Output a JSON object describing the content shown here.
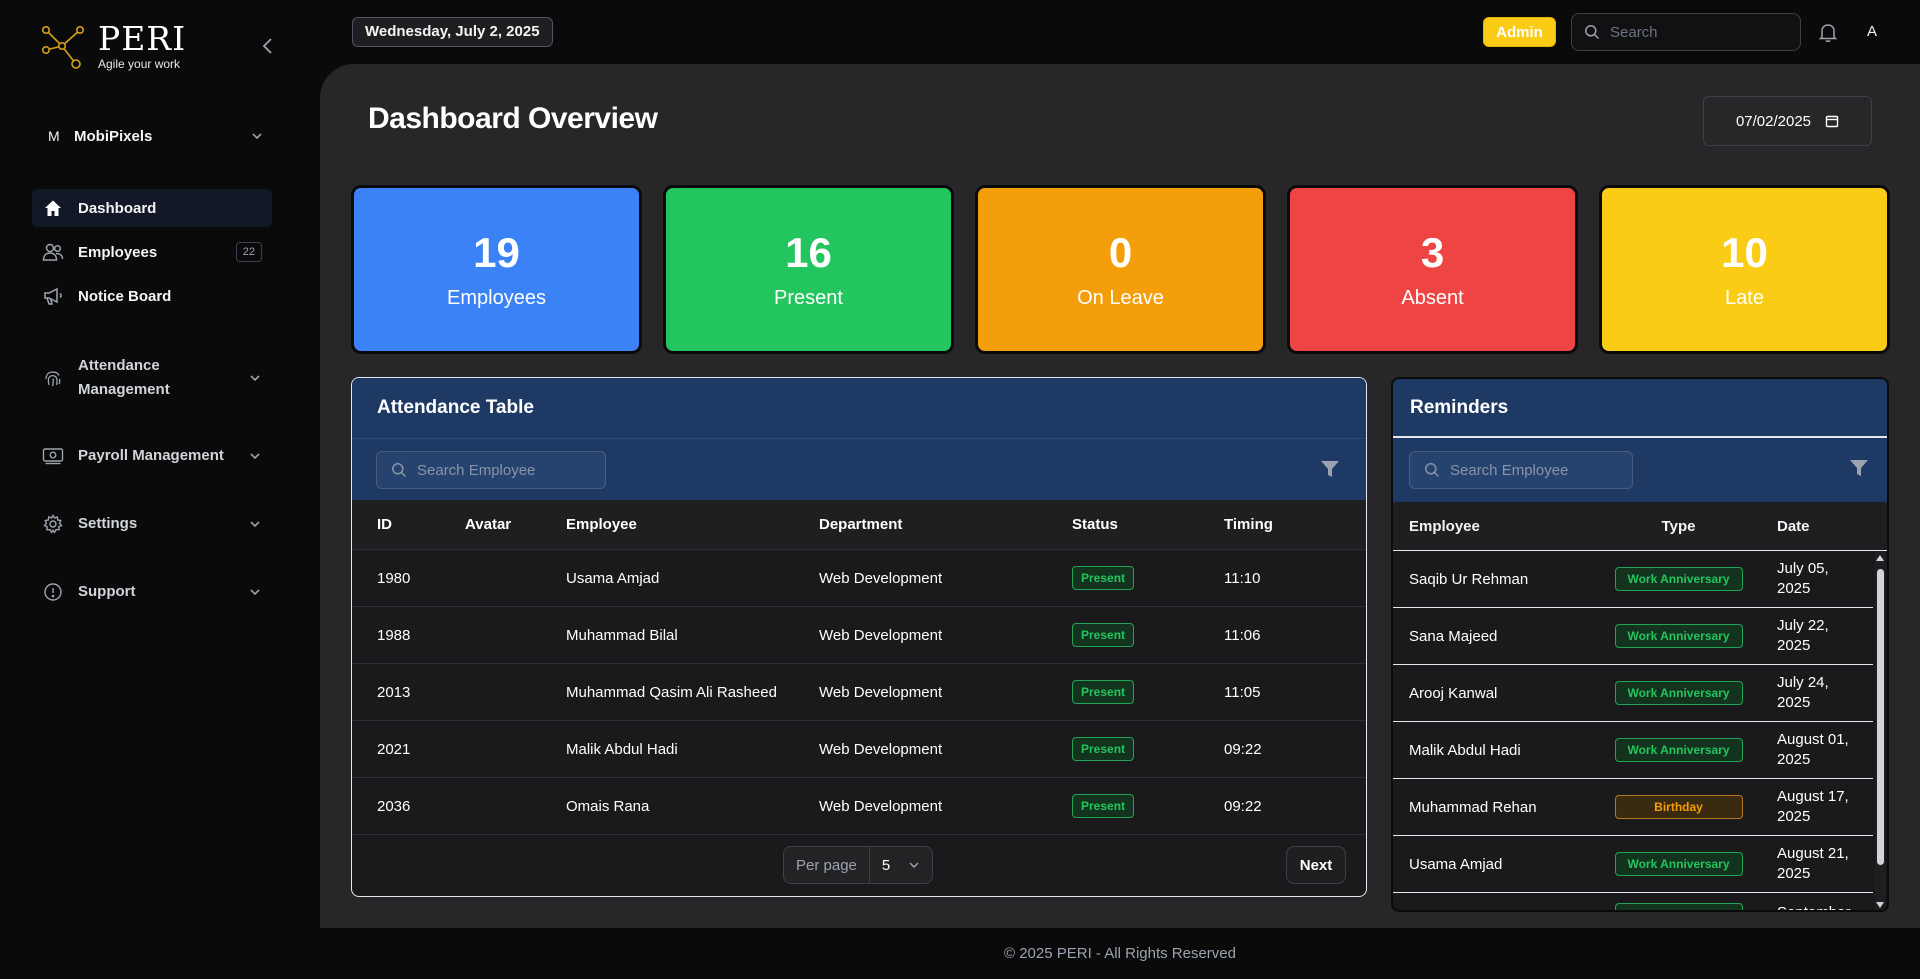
{
  "brand": {
    "name": "PERI",
    "tagline": "Agile your work"
  },
  "org": {
    "initial": "M",
    "name": "MobiPixels"
  },
  "nav": [
    {
      "label": "Dashboard",
      "icon": "home-icon",
      "active": true
    },
    {
      "label": "Employees",
      "icon": "users-icon",
      "badge": "22"
    },
    {
      "label": "Notice Board",
      "icon": "megaphone-icon"
    }
  ],
  "groups": [
    {
      "label": "Attendance Management",
      "icon": "fingerprint-icon"
    },
    {
      "label": "Payroll Management",
      "icon": "money-icon"
    },
    {
      "label": "Settings",
      "icon": "gear-icon"
    },
    {
      "label": "Support",
      "icon": "info-icon"
    }
  ],
  "topbar": {
    "date": "Wednesday, July 2, 2025",
    "role": "Admin",
    "search_placeholder": "Search",
    "user_initial": "A"
  },
  "page": {
    "title": "Dashboard Overview",
    "date_value": "07/02/2025"
  },
  "stats": [
    {
      "value": "19",
      "label": "Employees",
      "color": "#3b82f6"
    },
    {
      "value": "16",
      "label": "Present",
      "color": "#22c55e"
    },
    {
      "value": "0",
      "label": "On Leave",
      "color": "#f59e0b"
    },
    {
      "value": "3",
      "label": "Absent",
      "color": "#ef4444"
    },
    {
      "value": "10",
      "label": "Late",
      "color": "#facc15"
    }
  ],
  "attendance": {
    "title": "Attendance Table",
    "search_placeholder": "Search Employee",
    "columns": [
      "ID",
      "Avatar",
      "Employee",
      "Department",
      "Status",
      "Timing"
    ],
    "rows": [
      {
        "id": "1980",
        "employee": "Usama Amjad",
        "department": "Web Development",
        "status": "Present",
        "timing": "11:10"
      },
      {
        "id": "1988",
        "employee": "Muhammad Bilal",
        "department": "Web Development",
        "status": "Present",
        "timing": "11:06"
      },
      {
        "id": "2013",
        "employee": "Muhammad Qasim Ali Rasheed",
        "department": "Web Development",
        "status": "Present",
        "timing": "11:05"
      },
      {
        "id": "2021",
        "employee": "Malik Abdul Hadi",
        "department": "Web Development",
        "status": "Present",
        "timing": "09:22"
      },
      {
        "id": "2036",
        "employee": "Omais Rana",
        "department": "Web Development",
        "status": "Present",
        "timing": "09:22"
      }
    ],
    "per_page_label": "Per page",
    "per_page_value": "5",
    "next_label": "Next"
  },
  "reminders": {
    "title": "Reminders",
    "search_placeholder": "Search Employee",
    "columns": [
      "Employee",
      "Type",
      "Date"
    ],
    "rows": [
      {
        "employee": "Saqib Ur Rehman",
        "type": "Work Anniversary",
        "date": "July 05, 2025"
      },
      {
        "employee": "Sana Majeed",
        "type": "Work Anniversary",
        "date": "July 22, 2025"
      },
      {
        "employee": "Arooj Kanwal",
        "type": "Work Anniversary",
        "date": "July 24, 2025"
      },
      {
        "employee": "Malik Abdul Hadi",
        "type": "Work Anniversary",
        "date": "August 01, 2025"
      },
      {
        "employee": "Muhammad Rehan",
        "type": "Birthday",
        "date": "August 17, 2025"
      },
      {
        "employee": "Usama Amjad",
        "type": "Work Anniversary",
        "date": "August 21, 2025"
      },
      {
        "employee": "",
        "type": "Work Anniversary",
        "date": "September"
      }
    ]
  },
  "footer": "© 2025 PERI - All Rights Reserved"
}
